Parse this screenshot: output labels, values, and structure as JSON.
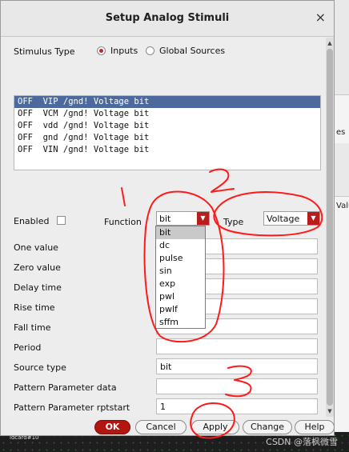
{
  "dialog": {
    "title": "Setup Analog Stimuli",
    "close_glyph": "×"
  },
  "stimulus_type": {
    "label": "Stimulus Type",
    "options": [
      {
        "label": "Inputs",
        "selected": true
      },
      {
        "label": "Global Sources",
        "selected": false
      }
    ]
  },
  "stimulus_list": [
    "OFF  VIP /gnd! Voltage bit",
    "OFF  VCM /gnd! Voltage bit",
    "OFF  vdd /gnd! Voltage bit",
    "OFF  gnd /gnd! Voltage bit",
    "OFF  VIN /gnd! Voltage bit"
  ],
  "enabled": {
    "label": "Enabled",
    "checked": false
  },
  "function": {
    "label": "Function",
    "value": "bit",
    "options": [
      "bit",
      "dc",
      "pulse",
      "sin",
      "exp",
      "pwl",
      "pwlf",
      "sffm"
    ]
  },
  "type": {
    "label": "Type",
    "value": "Voltage"
  },
  "fields": [
    {
      "label": "One value",
      "value": ""
    },
    {
      "label": "Zero value",
      "value": ""
    },
    {
      "label": "Delay time",
      "value": ""
    },
    {
      "label": "Rise time",
      "value": ""
    },
    {
      "label": "Fall time",
      "value": ""
    },
    {
      "label": "Period",
      "value": ""
    },
    {
      "label": "Source type",
      "value": "bit"
    },
    {
      "label": "Pattern Parameter data",
      "value": ""
    },
    {
      "label": "Pattern Parameter rptstart",
      "value": "1"
    }
  ],
  "buttons": {
    "ok": "OK",
    "cancel": "Cancel",
    "apply": "Apply",
    "change": "Change",
    "help": "Help"
  },
  "annotations": {
    "n1": "1",
    "n2": "2",
    "n3": "3",
    "color": "#ff1a1a"
  },
  "background": {
    "right_strip": [
      "es",
      "Valu"
    ],
    "bottom_label": "idcard#10",
    "watermark": "CSDN @落枫微雪"
  },
  "accent_color": "#b81c1c",
  "selection_color": "#4d6a9e"
}
